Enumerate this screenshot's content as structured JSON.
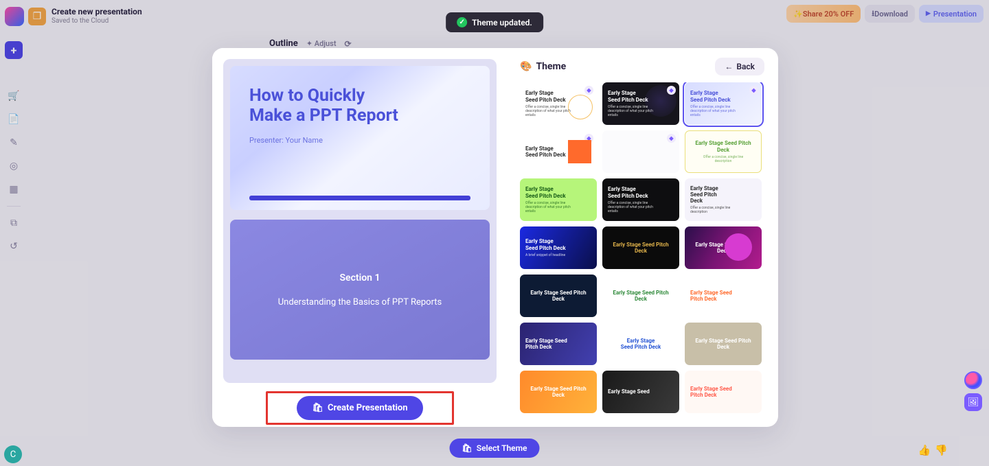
{
  "header": {
    "doc_title": "Create new presentation",
    "doc_sub": "Saved to the Cloud",
    "share_label": "Share 20% OFF",
    "download_label": "Download",
    "present_label": "Presentation"
  },
  "outline_bar": {
    "outline": "Outline",
    "adjust": "Adjust"
  },
  "toast": {
    "text": "Theme updated."
  },
  "modal": {
    "preview": {
      "title": "How to Quickly Make a PPT Report",
      "presenter": "Presenter: Your Name",
      "section_label": "Section 1",
      "section_sub": "Understanding the Basics of PPT Reports"
    },
    "create_btn": "Create Presentation",
    "theme_title": "Theme",
    "back_label": "Back",
    "themes": [
      {
        "title": "Early Stage\nSeed Pitch Deck",
        "sub": "Offer a concise, single line description of what your pitch entails",
        "diamond": true,
        "cls": "c0"
      },
      {
        "title": "Early Stage\nSeed Pitch Deck",
        "sub": "Offer a concise, single line description of what your pitch entails",
        "diamond": true,
        "cls": "c1"
      },
      {
        "title": "Early Stage\nSeed Pitch Deck",
        "sub": "Offer a concise, single line description of what your pitch entails",
        "diamond": true,
        "cls": "c2",
        "selected": true
      },
      {
        "title": "Early Stage\nSeed Pitch Deck",
        "sub": "",
        "diamond": true,
        "cls": "c3"
      },
      {
        "title": "",
        "sub": "",
        "diamond": true,
        "cls": "c4"
      },
      {
        "title": "Early Stage Seed Pitch Deck",
        "sub": "Offer a concise, single line description",
        "diamond": false,
        "cls": "c5"
      },
      {
        "title": "Early Stage\nSeed Pitch Deck",
        "sub": "Offer a concise, single line description of what your pitch entails",
        "diamond": false,
        "cls": "c6"
      },
      {
        "title": "Early Stage\nSeed Pitch Deck",
        "sub": "Offer a concise, single line description of what your pitch entails",
        "diamond": false,
        "cls": "c7"
      },
      {
        "title": "Early Stage\nSeed Pitch\nDeck",
        "sub": "Offer a concise, single line description",
        "diamond": false,
        "cls": "c8"
      },
      {
        "title": "Early Stage\nSeed Pitch Deck",
        "sub": "A brief snippet of headline",
        "diamond": false,
        "cls": "c9"
      },
      {
        "title": "Early Stage Seed Pitch Deck",
        "sub": "",
        "diamond": false,
        "cls": "c10"
      },
      {
        "title": "Early Stage Seed Pitch Deck",
        "sub": "",
        "diamond": false,
        "cls": "c11"
      },
      {
        "title": "Early Stage Seed Pitch Deck",
        "sub": "",
        "diamond": false,
        "cls": "c12"
      },
      {
        "title": "Early Stage Seed Pitch Deck",
        "sub": "",
        "diamond": false,
        "cls": "c13"
      },
      {
        "title": "Early Stage Seed\nPitch Deck",
        "sub": "",
        "diamond": false,
        "cls": "c14"
      },
      {
        "title": "Early Stage Seed\nPitch Deck",
        "sub": "",
        "diamond": false,
        "cls": "c15"
      },
      {
        "title": "Early Stage\nSeed Pitch Deck",
        "sub": "",
        "diamond": false,
        "cls": "c16"
      },
      {
        "title": "Early Stage Seed Pitch Deck",
        "sub": "",
        "diamond": false,
        "cls": "c17"
      },
      {
        "title": "Early Stage Seed Pitch Deck",
        "sub": "",
        "diamond": false,
        "cls": "c18"
      },
      {
        "title": "Early Stage Seed",
        "sub": "",
        "diamond": false,
        "cls": "c19"
      },
      {
        "title": "Early Stage Seed\nPitch Deck",
        "sub": "",
        "diamond": false,
        "cls": "c20"
      },
      {
        "title": "",
        "sub": "",
        "diamond": false,
        "cls": "c21"
      }
    ]
  },
  "bottom": {
    "select_theme": "Select Theme"
  }
}
